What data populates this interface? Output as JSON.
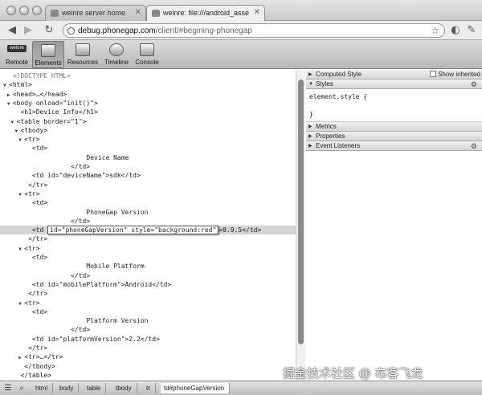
{
  "browser": {
    "tabs": [
      {
        "title": "weinre server home",
        "active": false
      },
      {
        "title": "weinre: file:///android_asse",
        "active": true
      }
    ],
    "url_host": "debug.phonegap.com",
    "url_path": "/client/#begining-phonegap",
    "back_icon": "back-arrow-icon",
    "forward_icon": "forward-arrow-icon",
    "reload_icon": "reload-icon"
  },
  "toolbar": {
    "tools": [
      {
        "label": "Remote",
        "badge": "weinre"
      },
      {
        "label": "Elements",
        "selected": true
      },
      {
        "label": "Resources"
      },
      {
        "label": "Timeline"
      },
      {
        "label": "Console"
      }
    ]
  },
  "dom_tree": {
    "lines": [
      {
        "text": "<!DOCTYPE HTML>",
        "indent": 1,
        "tri": "",
        "kind": "comment"
      },
      {
        "text": "<html>",
        "indent": 0,
        "tri": "▼"
      },
      {
        "text": "<head>…</head>",
        "indent": 1,
        "tri": "▶"
      },
      {
        "text": "<body onload=\"init()\">",
        "indent": 1,
        "tri": "▼"
      },
      {
        "text": "<h1>Device Info</h1>",
        "indent": 3,
        "tri": ""
      },
      {
        "text": "<table border=\"1\">",
        "indent": 2,
        "tri": "▼"
      },
      {
        "text": "<tbody>",
        "indent": 3,
        "tri": "▼"
      },
      {
        "text": "<tr>",
        "indent": 4,
        "tri": "▼"
      },
      {
        "text": "<td>",
        "indent": 6,
        "tri": ""
      },
      {
        "text": "Device Name",
        "indent": 20,
        "tri": ""
      },
      {
        "text": "</td>",
        "indent": 16,
        "tri": ""
      },
      {
        "text": "<td id=\"deviceName\">sdk</td>",
        "indent": 6,
        "tri": ""
      },
      {
        "text": "</tr>",
        "indent": 5,
        "tri": ""
      },
      {
        "text": "<tr>",
        "indent": 4,
        "tri": "▼"
      },
      {
        "text": "<td>",
        "indent": 6,
        "tri": ""
      },
      {
        "text": "PhoneGap Version",
        "indent": 20,
        "tri": ""
      },
      {
        "text": "</td>",
        "indent": 16,
        "tri": ""
      },
      {
        "text": "<td ",
        "indent": 6,
        "tri": "",
        "kind": "selected",
        "edit": "id=\"phoneGapVersion\" style=\"background:red\"",
        "after": ">0.9.5</td>"
      },
      {
        "text": "</tr>",
        "indent": 5,
        "tri": ""
      },
      {
        "text": "<tr>",
        "indent": 4,
        "tri": "▼"
      },
      {
        "text": "<td>",
        "indent": 6,
        "tri": ""
      },
      {
        "text": "Mobile Platform",
        "indent": 20,
        "tri": ""
      },
      {
        "text": "</td>",
        "indent": 16,
        "tri": ""
      },
      {
        "text": "<td id=\"mobilePlatform\">Android</td>",
        "indent": 6,
        "tri": ""
      },
      {
        "text": "</tr>",
        "indent": 5,
        "tri": ""
      },
      {
        "text": "<tr>",
        "indent": 4,
        "tri": "▼"
      },
      {
        "text": "<td>",
        "indent": 6,
        "tri": ""
      },
      {
        "text": "Platform Version",
        "indent": 20,
        "tri": ""
      },
      {
        "text": "</td>",
        "indent": 16,
        "tri": ""
      },
      {
        "text": "<td id=\"platformVersion\">2.2</td>",
        "indent": 6,
        "tri": ""
      },
      {
        "text": "</tr>",
        "indent": 5,
        "tri": ""
      },
      {
        "text": "<tr>…</tr>",
        "indent": 4,
        "tri": "▶"
      },
      {
        "text": "</tbody>",
        "indent": 4,
        "tri": ""
      },
      {
        "text": "</table>",
        "indent": 3,
        "tri": ""
      }
    ]
  },
  "sidebar": {
    "computed_style": "Computed Style",
    "show_inherited": "Show inherited",
    "styles": "Styles",
    "element_style": "element.style {",
    "element_style_close": "}",
    "metrics": "Metrics",
    "properties": "Properties",
    "event_listeners": "Event Listeners"
  },
  "breadcrumbs": [
    "html",
    "body",
    "table",
    "tbody",
    "tr",
    "td#phoneGapVersion"
  ],
  "watermark": "掘金技术社区 @ 布客飞龙"
}
